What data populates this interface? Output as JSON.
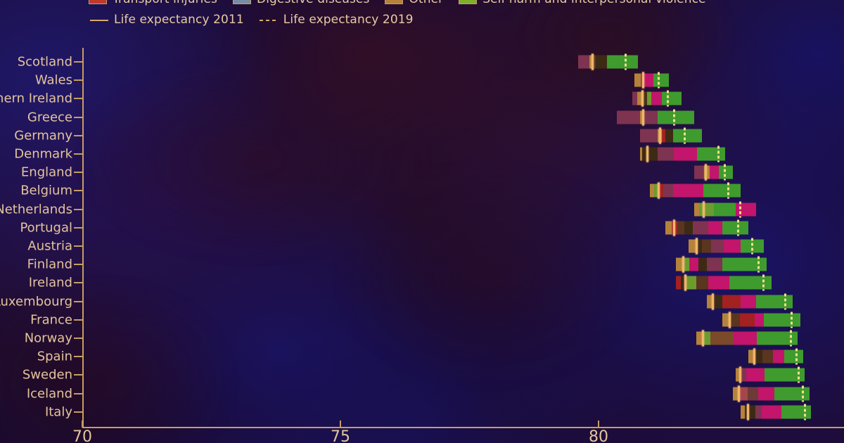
{
  "legend": {
    "categories": [
      {
        "label": "Transport injuries",
        "color": "#c0392b"
      },
      {
        "label": "Digestive diseases",
        "color": "#7b8ba3"
      },
      {
        "label": "Other",
        "color": "#b5823a"
      },
      {
        "label": "Self-harm and interpersonal violence",
        "color": "#7fae28"
      }
    ],
    "lines": [
      {
        "label": "Life expectancy 2011",
        "style": "solid",
        "color": "#d8a96f"
      },
      {
        "label": "Life expectancy 2019",
        "style": "dotted",
        "color": "#d8a96f"
      }
    ]
  },
  "axis": {
    "x_ticks": [
      "70",
      "75",
      "80"
    ],
    "x_min": 70,
    "x_max": 84.8
  },
  "colors": {
    "background": "#1b0b33",
    "axis": "#c79d63",
    "text": "#e4c49c",
    "le2011": "#f0b56a",
    "le2019": "#f2e08a"
  },
  "chart_data": {
    "type": "bar",
    "title": "",
    "xlabel": "",
    "ylabel": "",
    "xlim": [
      70,
      84.8
    ],
    "grid": false,
    "legend_position": "top",
    "stacked": true,
    "categories": [
      "Scotland",
      "Wales",
      "Northern Ireland",
      "Greece",
      "Germany",
      "Denmark",
      "England",
      "Belgium",
      "Netherlands",
      "Portugal",
      "Austria",
      "Finland",
      "Ireland",
      "Luxembourg",
      "France",
      "Norway",
      "Spain",
      "Sweden",
      "Iceland",
      "Italy"
    ],
    "series_colors": {
      "cardiovascular": "#8e3a5e",
      "neoplasms": "#c2156b",
      "respiratory": "#5e3a2a",
      "neurological": "#4a3318",
      "transport_injuries": "#c0392b",
      "digestive": "#7b8ba3",
      "other": "#b5823a",
      "self_harm": "#3f9b2e"
    },
    "bars": [
      {
        "country": "Scotland",
        "start": 79.6,
        "end": 80.75,
        "le2011": 79.87,
        "le2019": 80.5,
        "segments": [
          {
            "name": "cardiovascular",
            "width": 0.22,
            "color": "#7e3350"
          },
          {
            "name": "other",
            "width": 0.07,
            "color": "#b5823a"
          },
          {
            "name": "respiratory",
            "width": 0.06,
            "color": "#5a3520"
          },
          {
            "name": "neurological",
            "width": 0.22,
            "color": "#3d2a14"
          },
          {
            "name": "self_harm",
            "width": 0.58,
            "color": "#3f9b2e"
          }
        ]
      },
      {
        "country": "Wales",
        "start": 80.7,
        "end": 81.35,
        "le2011": 80.85,
        "le2019": 81.15,
        "segments": [
          {
            "name": "other",
            "width": 0.12,
            "color": "#b5823a"
          },
          {
            "name": "cardiovascular",
            "width": 0.05,
            "color": "#7e3350"
          },
          {
            "name": "neoplasms",
            "width": 0.19,
            "color": "#c2156b"
          },
          {
            "name": "self_harm",
            "width": 0.29,
            "color": "#3f9b2e"
          }
        ]
      },
      {
        "country": "Northern Ireland",
        "start": 80.65,
        "end": 81.6,
        "le2011": 80.83,
        "le2019": 81.32,
        "segments": [
          {
            "name": "cardiovascular",
            "width": 0.1,
            "color": "#7e3350"
          },
          {
            "name": "other",
            "width": 0.09,
            "color": "#b5823a"
          },
          {
            "name": "neurological",
            "width": 0.1,
            "color": "#4a3318"
          },
          {
            "name": "self_harm_s",
            "width": 0.08,
            "color": "#6c9b2e"
          },
          {
            "name": "neoplasms",
            "width": 0.2,
            "color": "#c2156b"
          },
          {
            "name": "self_harm",
            "width": 0.38,
            "color": "#3f9b2e"
          }
        ]
      },
      {
        "country": "Greece",
        "start": 80.35,
        "end": 81.85,
        "le2011": 80.84,
        "le2019": 81.45,
        "segments": [
          {
            "name": "cardiovascular",
            "width": 0.45,
            "color": "#7e3350"
          },
          {
            "name": "other",
            "width": 0.09,
            "color": "#b5823a"
          },
          {
            "name": "cardiovascular2",
            "width": 0.26,
            "color": "#7e3350"
          },
          {
            "name": "self_harm",
            "width": 0.7,
            "color": "#3f9b2e"
          }
        ]
      },
      {
        "country": "Germany",
        "start": 80.8,
        "end": 82.0,
        "le2011": 81.17,
        "le2019": 81.65,
        "segments": [
          {
            "name": "cardiovascular",
            "width": 0.34,
            "color": "#7e3350"
          },
          {
            "name": "other",
            "width": 0.08,
            "color": "#b5823a"
          },
          {
            "name": "transport_injuries",
            "width": 0.08,
            "color": "#a32121"
          },
          {
            "name": "neurological",
            "width": 0.14,
            "color": "#3d2a14"
          },
          {
            "name": "self_harm",
            "width": 0.56,
            "color": "#3f9b2e"
          }
        ]
      },
      {
        "country": "Denmark",
        "start": 80.8,
        "end": 82.45,
        "le2011": 80.92,
        "le2019": 82.3,
        "segments": [
          {
            "name": "other",
            "width": 0.05,
            "color": "#b5823a"
          },
          {
            "name": "neurological",
            "width": 0.3,
            "color": "#3d2a14"
          },
          {
            "name": "cardiovascular",
            "width": 0.31,
            "color": "#7e3350"
          },
          {
            "name": "neoplasms",
            "width": 0.45,
            "color": "#c2156b"
          },
          {
            "name": "self_harm",
            "width": 0.54,
            "color": "#3f9b2e"
          }
        ]
      },
      {
        "country": "England",
        "start": 81.85,
        "end": 82.6,
        "le2011": 82.06,
        "le2019": 82.42,
        "segments": [
          {
            "name": "cardiovascular",
            "width": 0.2,
            "color": "#7e3350"
          },
          {
            "name": "other",
            "width": 0.1,
            "color": "#b5823a"
          },
          {
            "name": "neoplasms",
            "width": 0.18,
            "color": "#c2156b"
          },
          {
            "name": "self_harm",
            "width": 0.27,
            "color": "#3f9b2e"
          }
        ]
      },
      {
        "country": "Belgium",
        "start": 81.0,
        "end": 82.75,
        "le2011": 81.14,
        "le2019": 82.5,
        "segments": [
          {
            "name": "other",
            "width": 0.07,
            "color": "#b5823a"
          },
          {
            "name": "self_harm_s",
            "width": 0.08,
            "color": "#6c9b2e"
          },
          {
            "name": "transport_injuries",
            "width": 0.11,
            "color": "#a32121"
          },
          {
            "name": "cardiovascular",
            "width": 0.18,
            "color": "#7e3350"
          },
          {
            "name": "neoplasms",
            "width": 0.59,
            "color": "#c2156b"
          },
          {
            "name": "self_harm",
            "width": 0.72,
            "color": "#3f9b2e"
          }
        ]
      },
      {
        "country": "Netherlands",
        "start": 81.85,
        "end": 83.05,
        "le2011": 82.01,
        "le2019": 82.73,
        "segments": [
          {
            "name": "other",
            "width": 0.1,
            "color": "#b5823a"
          },
          {
            "name": "self_harm_s",
            "width": 0.28,
            "color": "#6c9b2e"
          },
          {
            "name": "self_harm",
            "width": 0.42,
            "color": "#3f9b2e"
          },
          {
            "name": "neoplasms",
            "width": 0.4,
            "color": "#c2156b"
          }
        ]
      },
      {
        "country": "Portugal",
        "start": 81.3,
        "end": 82.9,
        "le2011": 81.45,
        "le2019": 82.68,
        "segments": [
          {
            "name": "other",
            "width": 0.12,
            "color": "#b5823a"
          },
          {
            "name": "transport_injuries",
            "width": 0.1,
            "color": "#a32121"
          },
          {
            "name": "respiratory",
            "width": 0.14,
            "color": "#5a3520"
          },
          {
            "name": "neurological",
            "width": 0.17,
            "color": "#3d2a14"
          },
          {
            "name": "cardiovascular",
            "width": 0.3,
            "color": "#7e3350"
          },
          {
            "name": "neoplasms",
            "width": 0.27,
            "color": "#c2156b"
          },
          {
            "name": "self_harm",
            "width": 0.5,
            "color": "#3f9b2e"
          }
        ]
      },
      {
        "country": "Austria",
        "start": 81.75,
        "end": 83.2,
        "le2011": 81.88,
        "le2019": 82.95,
        "segments": [
          {
            "name": "other",
            "width": 0.13,
            "color": "#b5823a"
          },
          {
            "name": "neurological",
            "width": 0.12,
            "color": "#3d2a14"
          },
          {
            "name": "respiratory",
            "width": 0.18,
            "color": "#5a3520"
          },
          {
            "name": "cardiovascular",
            "width": 0.25,
            "color": "#7e3350"
          },
          {
            "name": "neoplasms",
            "width": 0.32,
            "color": "#c2156b"
          },
          {
            "name": "self_harm",
            "width": 0.45,
            "color": "#3f9b2e"
          }
        ]
      },
      {
        "country": "Finland",
        "start": 81.5,
        "end": 83.25,
        "le2011": 81.62,
        "le2019": 83.08,
        "segments": [
          {
            "name": "other",
            "width": 0.12,
            "color": "#b5823a"
          },
          {
            "name": "self_harm_s",
            "width": 0.14,
            "color": "#6c9b2e"
          },
          {
            "name": "neoplasms",
            "width": 0.17,
            "color": "#c2156b"
          },
          {
            "name": "neurological",
            "width": 0.17,
            "color": "#3d2a14"
          },
          {
            "name": "cardiovascular",
            "width": 0.3,
            "color": "#7e3350"
          },
          {
            "name": "self_harm",
            "width": 0.85,
            "color": "#3f9b2e"
          }
        ]
      },
      {
        "country": "Ireland",
        "start": 81.5,
        "end": 83.35,
        "le2011": 81.66,
        "le2019": 83.18,
        "segments": [
          {
            "name": "transport_injuries",
            "width": 0.1,
            "color": "#a32121"
          },
          {
            "name": "neurological",
            "width": 0.1,
            "color": "#3d2a14"
          },
          {
            "name": "self_harm_s",
            "width": 0.2,
            "color": "#6c9b2e"
          },
          {
            "name": "respiratory",
            "width": 0.23,
            "color": "#5a3520"
          },
          {
            "name": "neoplasms",
            "width": 0.4,
            "color": "#c2156b"
          },
          {
            "name": "self_harm",
            "width": 0.82,
            "color": "#3f9b2e"
          }
        ]
      },
      {
        "country": "Luxembourg",
        "start": 82.1,
        "end": 83.75,
        "le2011": 82.2,
        "le2019": 83.6,
        "segments": [
          {
            "name": "other",
            "width": 0.14,
            "color": "#b5823a"
          },
          {
            "name": "neurological",
            "width": 0.16,
            "color": "#3d2a14"
          },
          {
            "name": "transport_injuries",
            "width": 0.35,
            "color": "#a32121"
          },
          {
            "name": "neoplasms",
            "width": 0.3,
            "color": "#c2156b"
          },
          {
            "name": "self_harm",
            "width": 0.7,
            "color": "#3f9b2e"
          }
        ]
      },
      {
        "country": "France",
        "start": 82.4,
        "end": 83.9,
        "le2011": 82.52,
        "le2019": 83.72,
        "segments": [
          {
            "name": "other",
            "width": 0.12,
            "color": "#b5823a"
          },
          {
            "name": "respiratory",
            "width": 0.22,
            "color": "#5a3520"
          },
          {
            "name": "transport_injuries",
            "width": 0.28,
            "color": "#a32121"
          },
          {
            "name": "neoplasms",
            "width": 0.18,
            "color": "#c2156b"
          },
          {
            "name": "self_harm",
            "width": 0.7,
            "color": "#3f9b2e"
          }
        ]
      },
      {
        "country": "Norway",
        "start": 81.9,
        "end": 83.85,
        "le2011": 82.0,
        "le2019": 83.7,
        "segments": [
          {
            "name": "other",
            "width": 0.1,
            "color": "#b5823a"
          },
          {
            "name": "self_harm_s",
            "width": 0.16,
            "color": "#6c9b2e"
          },
          {
            "name": "respiratory",
            "width": 0.45,
            "color": "#7a4a2a"
          },
          {
            "name": "neoplasms",
            "width": 0.45,
            "color": "#c2156b"
          },
          {
            "name": "self_harm",
            "width": 0.79,
            "color": "#3f9b2e"
          }
        ]
      },
      {
        "country": "Spain",
        "start": 82.9,
        "end": 83.95,
        "le2011": 83.0,
        "le2019": 83.82,
        "segments": [
          {
            "name": "other",
            "width": 0.1,
            "color": "#b5823a"
          },
          {
            "name": "neurological",
            "width": 0.18,
            "color": "#3d2a14"
          },
          {
            "name": "respiratory",
            "width": 0.2,
            "color": "#5a3520"
          },
          {
            "name": "neoplasms",
            "width": 0.22,
            "color": "#c2156b"
          },
          {
            "name": "self_harm",
            "width": 0.35,
            "color": "#3f9b2e"
          }
        ]
      },
      {
        "country": "Sweden",
        "start": 82.65,
        "end": 83.98,
        "le2011": 82.73,
        "le2019": 83.85,
        "segments": [
          {
            "name": "other",
            "width": 0.08,
            "color": "#b5823a"
          },
          {
            "name": "cardiovascular",
            "width": 0.13,
            "color": "#7e3350"
          },
          {
            "name": "neoplasms",
            "width": 0.35,
            "color": "#c2156b"
          },
          {
            "name": "self_harm",
            "width": 0.77,
            "color": "#3f9b2e"
          }
        ]
      },
      {
        "country": "Iceland",
        "start": 82.6,
        "end": 84.08,
        "le2011": 82.7,
        "le2019": 83.94,
        "segments": [
          {
            "name": "other",
            "width": 0.11,
            "color": "#b5823a"
          },
          {
            "name": "transport_injuries",
            "width": 0.18,
            "color": "#a5464a"
          },
          {
            "name": "respiratory",
            "width": 0.2,
            "color": "#6e3a38"
          },
          {
            "name": "neoplasms",
            "width": 0.32,
            "color": "#c2156b"
          },
          {
            "name": "self_harm",
            "width": 0.67,
            "color": "#3f9b2e"
          }
        ]
      },
      {
        "country": "Italy",
        "start": 82.75,
        "end": 84.1,
        "le2011": 82.88,
        "le2019": 83.98,
        "segments": [
          {
            "name": "other",
            "width": 0.09,
            "color": "#b5823a"
          },
          {
            "name": "neurological",
            "width": 0.2,
            "color": "#3d2a14"
          },
          {
            "name": "cardiovascular",
            "width": 0.12,
            "color": "#7e3350"
          },
          {
            "name": "neoplasms",
            "width": 0.38,
            "color": "#c2156b"
          },
          {
            "name": "self_harm",
            "width": 0.56,
            "color": "#3f9b2e"
          }
        ]
      }
    ]
  }
}
